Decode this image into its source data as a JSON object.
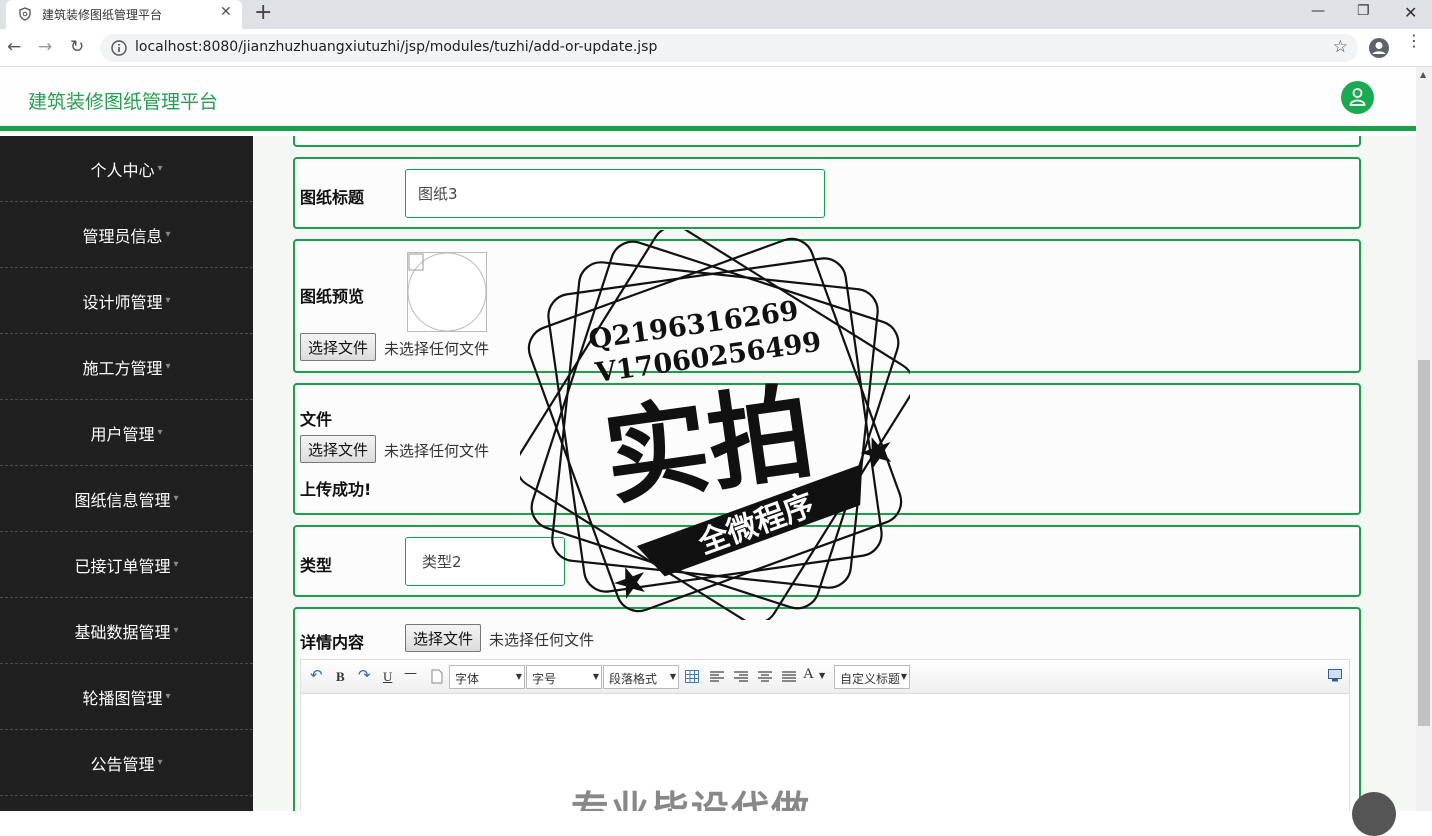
{
  "browser": {
    "tab_title": "建筑装修图纸管理平台",
    "tab_close": "✕",
    "new_tab": "+",
    "url": "localhost:8080/jianzhuzhuangxiutuzhi/jsp/modules/tuzhi/add-or-update.jsp",
    "back": "←",
    "forward": "→",
    "reload": "↻",
    "bookmark": "☆",
    "menu": "⋮",
    "minimize": "—",
    "restore": "❐",
    "close": "✕"
  },
  "header": {
    "title": "建筑装修图纸管理平台"
  },
  "sidebar": {
    "items": [
      {
        "label": "个人中心"
      },
      {
        "label": "管理员信息"
      },
      {
        "label": "设计师管理"
      },
      {
        "label": "施工方管理"
      },
      {
        "label": "用户管理"
      },
      {
        "label": "图纸信息管理"
      },
      {
        "label": "已接订单管理"
      },
      {
        "label": "基础数据管理"
      },
      {
        "label": "轮播图管理"
      },
      {
        "label": "公告管理"
      }
    ]
  },
  "form": {
    "title_label": "图纸标题",
    "title_value": "图纸3",
    "preview_label": "图纸预览",
    "choose_file": "选择文件",
    "no_file": "未选择任何文件",
    "file_label": "文件",
    "upload_success": "上传成功!",
    "type_label": "类型",
    "type_value": "类型2",
    "detail_label": "详情内容"
  },
  "editor": {
    "font_family": "字体",
    "font_size": "字号",
    "paragraph": "段落格式",
    "custom_title": "自定义标题",
    "bold": "B",
    "underline": "U",
    "font_color": "A",
    "content_heading": "专业毕设代做"
  },
  "watermark": {
    "line1": "Q2196316269",
    "line2": "V17060256499",
    "big": "实拍",
    "banner": "全微程序"
  }
}
